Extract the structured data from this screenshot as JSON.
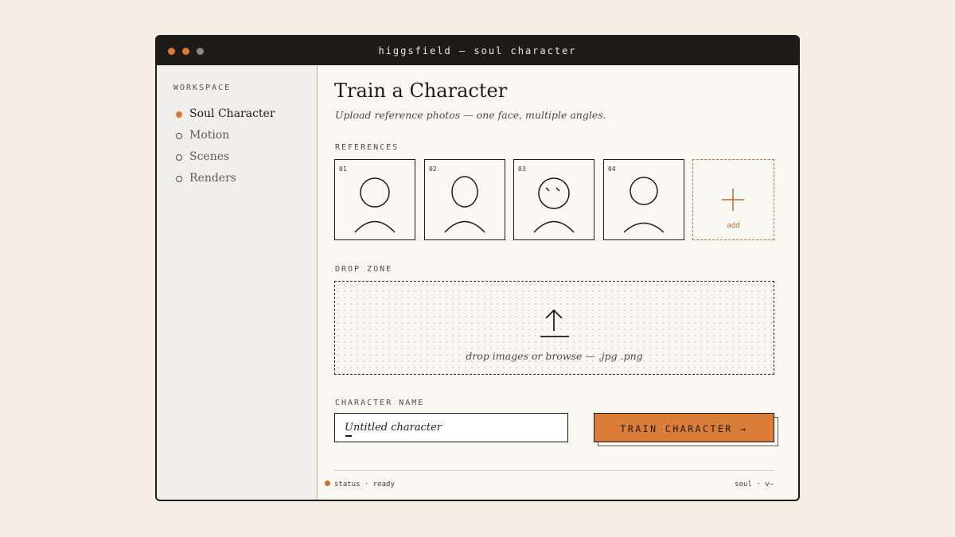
{
  "window": {
    "title": "higgsfield — soul character",
    "traffic_light_colors": [
      "#d97a36",
      "#d97a36",
      "#8c8780"
    ]
  },
  "sidebar": {
    "section_label": "WORKSPACE",
    "items": [
      {
        "label": "Soul Character",
        "active": true
      },
      {
        "label": "Motion",
        "active": false
      },
      {
        "label": "Scenes",
        "active": false
      },
      {
        "label": "Renders",
        "active": false
      }
    ]
  },
  "main": {
    "title": "Train a Character",
    "subtitle": "Upload reference photos — one face, multiple angles.",
    "references": {
      "label": "REFERENCES",
      "items": [
        {
          "number": "01",
          "icon": "face-front-icon"
        },
        {
          "number": "02",
          "icon": "face-oval-icon"
        },
        {
          "number": "03",
          "icon": "face-squint-icon"
        },
        {
          "number": "04",
          "icon": "face-front-icon"
        }
      ],
      "add_label": "add"
    },
    "drop_zone": {
      "label": "DROP ZONE",
      "text": "drop images or browse — .jpg .png",
      "icon": "upload-icon"
    },
    "character_name": {
      "label": "CHARACTER NAME",
      "value": "Untitled character"
    },
    "train_button": {
      "label": "TRAIN CHARACTER →"
    }
  },
  "footer": {
    "status": "status · ready",
    "version": "soul · v—"
  },
  "colors": {
    "accent": "#d97d38",
    "background": "#f6eee5",
    "window_bg": "#faf8f3",
    "sidebar_bg": "#f1efeb",
    "titlebar_bg": "#1e1b18",
    "ink": "#1c1a17"
  }
}
